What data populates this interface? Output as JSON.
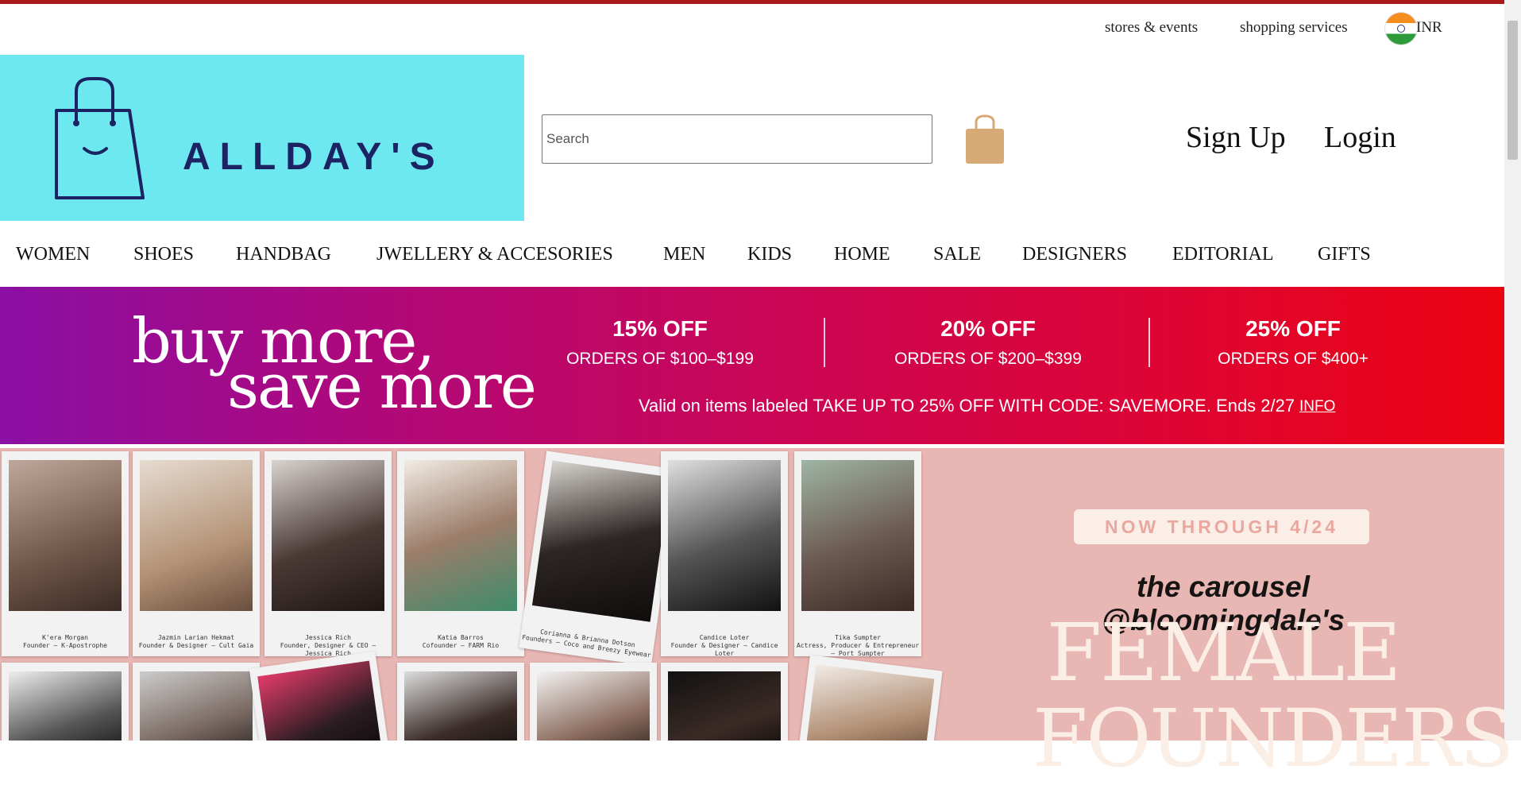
{
  "utility_links": {
    "stores": "stores & events",
    "services": "shopping services",
    "currency": "INR"
  },
  "brand": {
    "name": "ALLDAY'S"
  },
  "search": {
    "placeholder": "Search"
  },
  "auth": {
    "signup": "Sign Up",
    "login": "Login"
  },
  "nav": [
    "WOMEN",
    "SHOES",
    "HANDBAG",
    "JWELLERY & ACCESORIES",
    "MEN",
    "KIDS",
    "HOME",
    "SALE",
    "DESIGNERS",
    "EDITORIAL",
    "GIFTS"
  ],
  "promo": {
    "headline_1": "buy more,",
    "headline_2": "save more",
    "tiers": [
      {
        "discount": "15% OFF",
        "orders": "ORDERS OF $100–$199"
      },
      {
        "discount": "20% OFF",
        "orders": "ORDERS OF $200–$399"
      },
      {
        "discount": "25% OFF",
        "orders": "ORDERS OF $400+"
      }
    ],
    "validity": "Valid on items labeled TAKE UP TO 25% OFF WITH CODE: SAVEMORE. Ends 2/27",
    "info": "INFO"
  },
  "hero": {
    "badge": "NOW THROUGH 4/24",
    "carousel": "the carousel @bloomingdale's",
    "title_1": "FEMALE",
    "title_2": "FOUNDERS",
    "founders": [
      {
        "name": "K'era Morgan",
        "role": "Founder – K-Apostrophe"
      },
      {
        "name": "Jazmin Larian Hekmat",
        "role": "Founder & Designer – Cult Gaia"
      },
      {
        "name": "Jessica Rich",
        "role": "Founder, Designer & CEO – Jessica Rich"
      },
      {
        "name": "Katia Barros",
        "role": "Cofounder – FARM Rio"
      },
      {
        "name": "Corianna & Brianna Dotson",
        "role": "Founders – Coco and Breezy Eyewear"
      },
      {
        "name": "Candice Loter",
        "role": "Founder & Designer – Candice Loter"
      },
      {
        "name": "Tika Sumpter",
        "role": "Actress, Producer & Entrepreneur – Port Sumpter"
      }
    ]
  },
  "colors": {
    "topbar": "#a8191c",
    "logo_bg": "#6ee8f0",
    "logo_fg": "#1c2363",
    "bag": "#d7a977",
    "hero_bg": "#e8b6b3"
  }
}
